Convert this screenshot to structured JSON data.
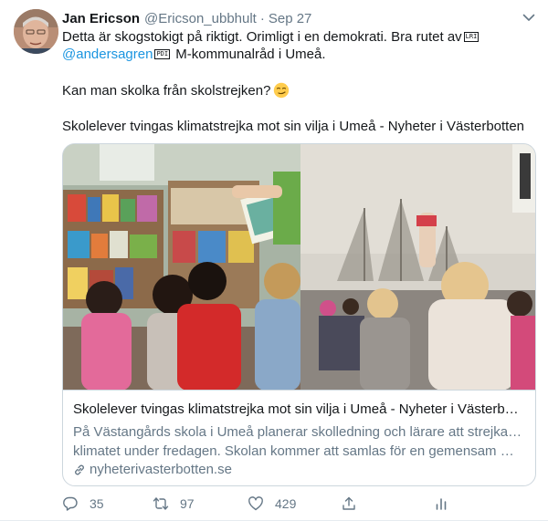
{
  "tweet": {
    "author_name": "Jan Ericson",
    "handle": "@Ericson_ubbhult",
    "separator": "·",
    "time": "Sep 27",
    "line1": "Detta är skogstokigt på riktigt. Orimligt i en demokrati. Bra rutet av",
    "tag_lri": "LRI",
    "mention": "@andersagren",
    "tag_pdi": "PDI",
    "line2_rest": " M-kommunalråd i Umeå.",
    "line3": "Kan man skolka från skolstrejken?",
    "line4": "Skolelever tvingas klimatstrejka mot sin vilja i Umeå - Nyheter i Västerbotten"
  },
  "card": {
    "title": "Skolelever tvingas klimatstrejka mot sin vilja i Umeå - Nyheter i Västerbotten",
    "desc_line1": "På Västangårds skola i Umeå planerar skolledning och lärare att strejka för",
    "desc_line2": "klimatet under fredagen. Skolan kommer att samlas för en gemensam manifestation",
    "domain": "nyheterivasterbotten.se"
  },
  "actions": {
    "replies": "35",
    "retweets": "97",
    "likes": "429"
  },
  "colors": {
    "link": "#1b95e0",
    "muted": "#657786",
    "text": "#14171a",
    "border": "#ccd6dd"
  },
  "icons": [
    "caret-down-icon",
    "smirk-emoji-icon",
    "link-icon",
    "reply-icon",
    "retweet-icon",
    "like-icon",
    "share-icon",
    "analytics-icon"
  ]
}
